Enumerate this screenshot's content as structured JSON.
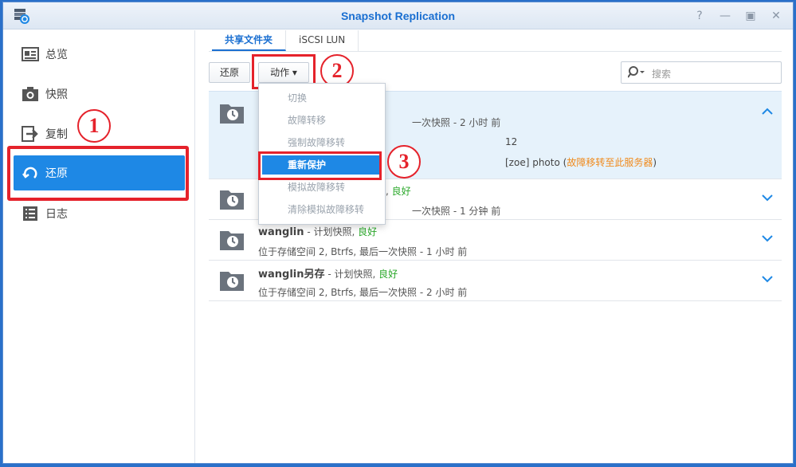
{
  "window": {
    "title": "Snapshot Replication"
  },
  "sidebar": {
    "items": [
      {
        "label": "总览",
        "icon": "overview-icon"
      },
      {
        "label": "快照",
        "icon": "camera-icon"
      },
      {
        "label": "复制",
        "icon": "replicate-icon"
      },
      {
        "label": "还原",
        "icon": "restore-icon",
        "active": true
      },
      {
        "label": "日志",
        "icon": "log-icon"
      }
    ]
  },
  "tabs": [
    {
      "label": "共享文件夹",
      "active": true
    },
    {
      "label": "iSCSI LUN",
      "active": false
    }
  ],
  "toolbar": {
    "restore_label": "还原",
    "action_label": "动作 ▾",
    "search_placeholder": "搜索"
  },
  "dropdown": {
    "items": [
      {
        "label": "切换",
        "enabled": false
      },
      {
        "label": "故障转移",
        "enabled": false
      },
      {
        "label": "强制故障移转",
        "enabled": false
      },
      {
        "label": "重新保护",
        "enabled": true,
        "highlighted": true
      },
      {
        "label": "模拟故障移转",
        "enabled": false
      },
      {
        "label": "清除模拟故障移转",
        "enabled": false
      }
    ]
  },
  "list": {
    "rows": [
      {
        "name": "",
        "status_prefix": "",
        "status": "",
        "desc": "一次快照 - 2 小时 前",
        "expanded": true,
        "details": [
          "12"
        ],
        "detail_owner": "[zoe] photo (",
        "detail_link": "故障移转至此服务器",
        "detail_close": ")"
      },
      {
        "name": "",
        "status_prefix": "照, ",
        "status": "良好",
        "desc": "一次快照 - 1 分钟 前"
      },
      {
        "name": "wanglin",
        "status_prefix": " - 计划快照, ",
        "status": "良好",
        "desc": "位于存储空间 2, Btrfs, 最后一次快照 - 1 小时 前"
      },
      {
        "name": "wanglin另存",
        "status_prefix": " - 计划快照, ",
        "status": "良好",
        "desc": "位于存储空间 2, Btrfs, 最后一次快照 - 2 小时 前"
      }
    ]
  },
  "annotations": {
    "step1": "1",
    "step2": "2",
    "step3": "3"
  },
  "colors": {
    "accent": "#1e88e5",
    "highlight_outline": "#e5222b",
    "good": "#2aa82a",
    "link": "#f08a1c",
    "title": "#1a6fd1"
  }
}
